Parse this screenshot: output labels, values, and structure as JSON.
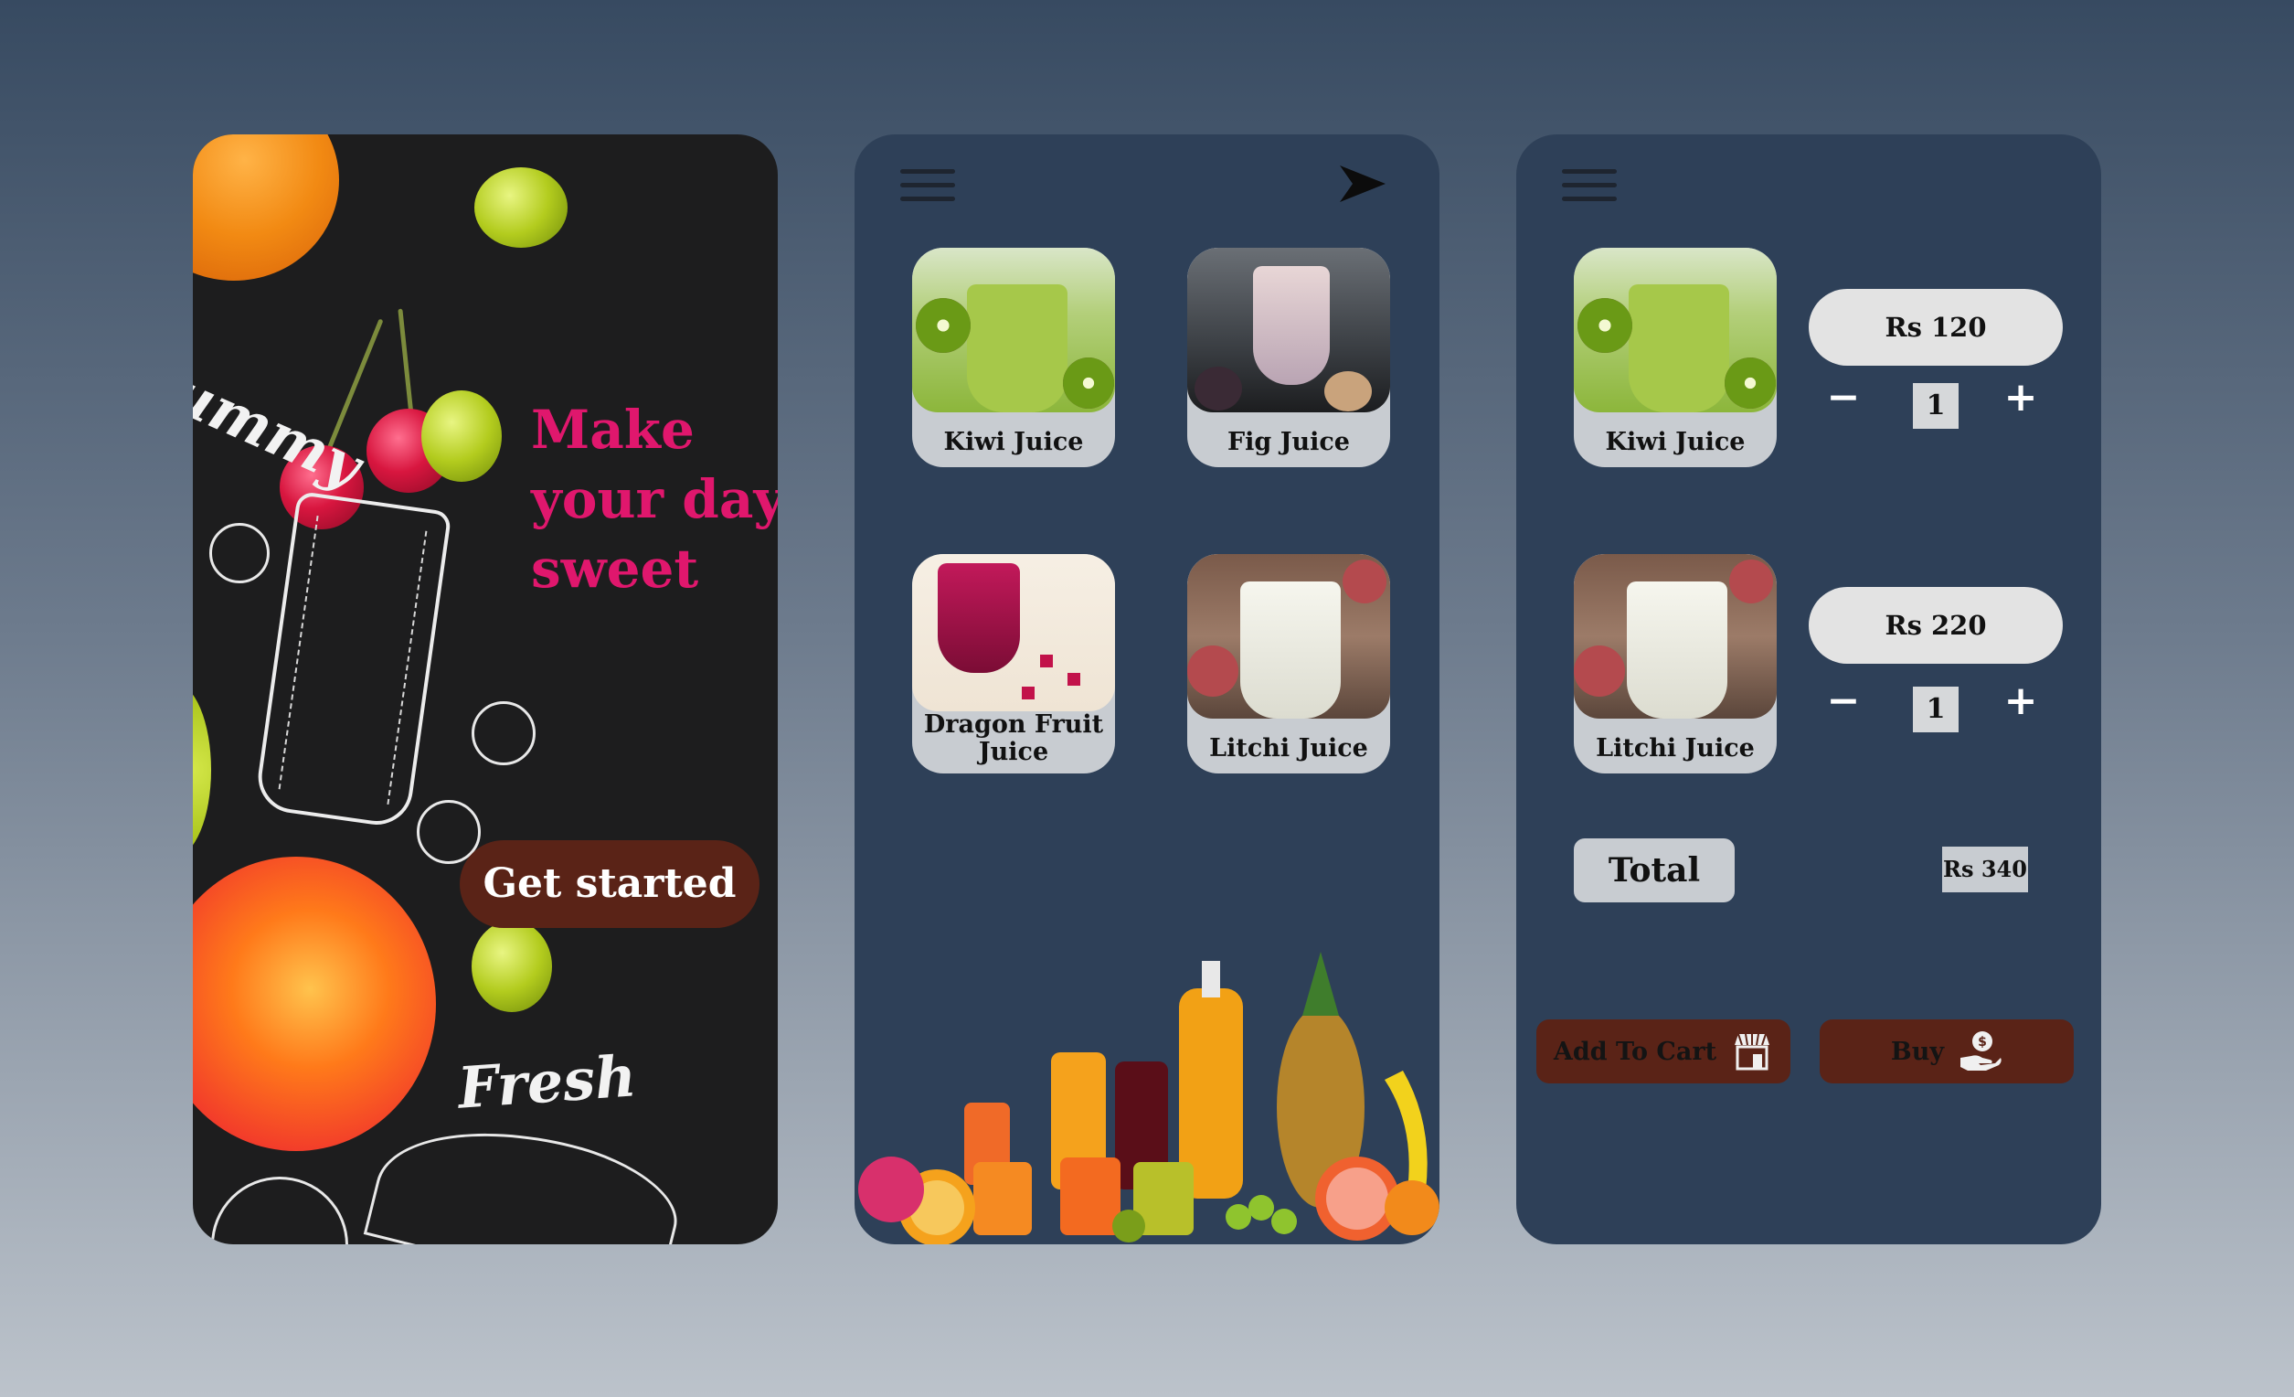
{
  "splash": {
    "script_top": "ummy",
    "tagline": [
      "Make",
      "your day",
      "sweet"
    ],
    "get_started": "Get started",
    "script_bottom": "Fresh"
  },
  "menu": {
    "items": [
      {
        "label": "Kiwi Juice"
      },
      {
        "label": "Fig Juice"
      },
      {
        "label": "Dragon Fruit Juice"
      },
      {
        "label": "Litchi Juice"
      }
    ]
  },
  "cart": {
    "items": [
      {
        "label": "Kiwi Juice",
        "price": "Rs 120",
        "qty": "1"
      },
      {
        "label": "Litchi Juice",
        "price": "Rs 220",
        "qty": "1"
      }
    ],
    "minus": "−",
    "plus": "+",
    "total_label": "Total",
    "total_value": "Rs 340",
    "add_to_cart": "Add To Cart",
    "buy": "Buy"
  },
  "colors": {
    "background_top": "#374a61",
    "screen_bg": "#2e4058",
    "accent_pink": "#e0176d",
    "button_brown": "#5a2317"
  },
  "icons": [
    "hamburger-icon",
    "arrow-right-icon",
    "store-icon",
    "hand-money-icon"
  ]
}
